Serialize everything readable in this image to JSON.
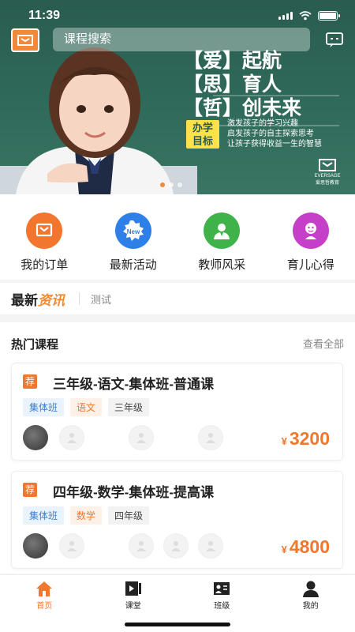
{
  "status_bar": {
    "time": "11:39"
  },
  "header": {
    "search_placeholder": "课程搜索"
  },
  "banner": {
    "slogan_lines": [
      "【爱】起航",
      "【思】育人",
      "【哲】创未来"
    ],
    "badge": [
      "办学",
      "目标"
    ],
    "sub_lines": [
      "激发孩子的学习兴趣",
      "启发孩子的自主探索思考",
      "让孩子获得收益一生的智慧"
    ],
    "corner_logo": "EVERSAGE 爱思哲教育"
  },
  "quick_menu": [
    {
      "label": "我的订单",
      "icon": "order-icon",
      "color": "#f2762e"
    },
    {
      "label": "最新活动",
      "icon": "new-icon",
      "color": "#2f7fe8"
    },
    {
      "label": "教师风采",
      "icon": "teacher-icon",
      "color": "#3fb34a"
    },
    {
      "label": "育儿心得",
      "icon": "parenting-icon",
      "color": "#c63fc9"
    }
  ],
  "news": {
    "title_a": "最新",
    "title_b": "资讯",
    "item": "测试"
  },
  "hot_courses": {
    "title": "热门课程",
    "more": "查看全部",
    "cards": [
      {
        "badge": "荐",
        "title": "三年级-语文-集体班-普通课",
        "tags": [
          "集体班",
          "语文",
          "三年级"
        ],
        "currency": "¥",
        "price": "3200"
      },
      {
        "badge": "荐",
        "title": "四年级-数学-集体班-提高课",
        "tags": [
          "集体班",
          "数学",
          "四年级"
        ],
        "currency": "¥",
        "price": "4800"
      }
    ]
  },
  "tabbar": [
    {
      "label": "首页",
      "icon": "home-icon"
    },
    {
      "label": "课堂",
      "icon": "classroom-icon"
    },
    {
      "label": "班级",
      "icon": "class-icon"
    },
    {
      "label": "我的",
      "icon": "profile-icon"
    }
  ],
  "colors": {
    "accent": "#f0782e",
    "banner": "#2f6a5a"
  }
}
